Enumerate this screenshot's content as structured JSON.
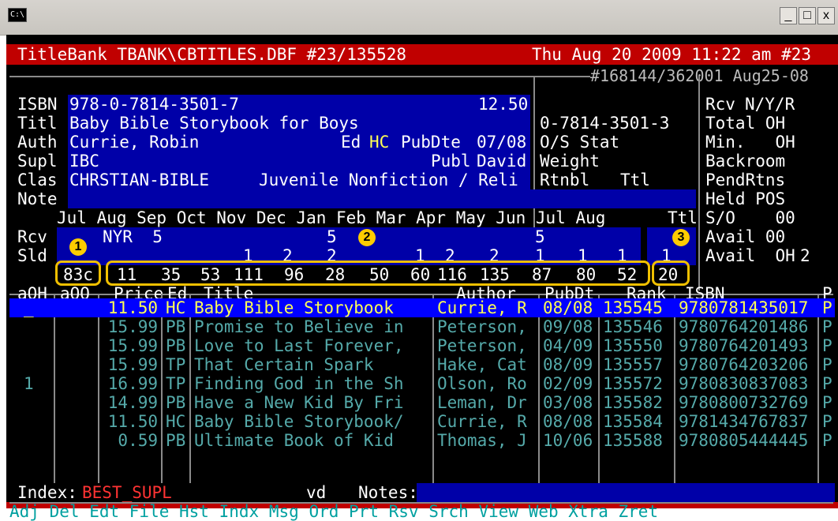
{
  "window": {
    "icon_label": "C:\\",
    "min_label": "_",
    "max_label": "□",
    "close_label": "x"
  },
  "header": {
    "left": "TitleBank TBANK\\CBTITLES.DBF #23/135528",
    "right": "Thu Aug 20 2009 11:22 am #23",
    "sub": "#168144/362001 Aug25-08"
  },
  "record": {
    "isbn_label": "ISBN",
    "isbn": "978-0-7814-3501-7",
    "price": "12.50",
    "titl_label": "Titl",
    "title": "Baby Bible Storybook for Boys",
    "isbn10": "0-7814-3501-3",
    "auth_label": "Auth",
    "author": "Currie, Robin",
    "ed_label": "Ed",
    "ed": "HC",
    "pubdte_label": "PubDte",
    "pubdte": "07/08",
    "os_label": "O/S Stat",
    "supl_label": "Supl",
    "supl": "IBC",
    "publ_label": "Publ",
    "publ": "David",
    "weight_label": "Weight",
    "clas_label": "Clas",
    "clas": "CHRSTIAN-BIBLE",
    "category": "Juvenile Nonfiction / Reli",
    "rtnbl_label": "Rtnbl",
    "ttl_label": "Ttl",
    "note_label": "Note"
  },
  "sidepanel": {
    "rcv_label": "Rcv",
    "rcv_value": "N/Y/R",
    "total": "Total OH",
    "min": "Min.   OH",
    "backroom": "Backroom",
    "pendrtns": "PendRtns",
    "held": "Held POS",
    "so": "S/O    00",
    "avail1": "Avail 00",
    "avail2": "Avail  OH",
    "avail2_val": "2"
  },
  "months": {
    "header": "Jul Aug Sep Oct Nov Dec Jan Feb Mar Apr May Jun Jul Aug",
    "ttl": "Ttl",
    "rcv_label": "Rcv",
    "rcv": "NYR  5",
    "rcv_jan": "5",
    "rcv_jun": "5",
    "sld_label": "Sld",
    "sld_vals": [
      "1",
      "2",
      "2",
      "1",
      "2",
      "2",
      "1",
      "1",
      "1",
      "1"
    ],
    "code": "83c",
    "sales": [
      "11",
      "35",
      "53",
      "111",
      "96",
      "28",
      "50",
      "60",
      "116",
      "135",
      "87",
      "80",
      "52"
    ],
    "total": "20"
  },
  "badges": {
    "one": "1",
    "two": "2",
    "three": "3"
  },
  "table": {
    "headers": {
      "aoh": "aOH",
      "aoo": "aOO",
      "price": "Price",
      "ed": "Ed",
      "title": "Title",
      "author": "Author",
      "pubdt": "PubDt",
      "rank": "Rank",
      "isbn": "ISBN",
      "p": "P"
    },
    "rows": [
      {
        "aoh": "_",
        "aoo": "",
        "price": "11.50",
        "ed": "HC",
        "title": "Baby Bible Storybook",
        "author": "Currie, R",
        "pubdt": "08/08",
        "rank": "135545",
        "isbn": "9780781435017",
        "p": "P"
      },
      {
        "aoh": "",
        "aoo": "",
        "price": "15.99",
        "ed": "PB",
        "title": "Promise to Believe in",
        "author": "Peterson,",
        "pubdt": "09/08",
        "rank": "135546",
        "isbn": "9780764201486",
        "p": "P"
      },
      {
        "aoh": "",
        "aoo": "",
        "price": "15.99",
        "ed": "PB",
        "title": "Love to Last Forever,",
        "author": "Peterson,",
        "pubdt": "04/09",
        "rank": "135550",
        "isbn": "9780764201493",
        "p": "P"
      },
      {
        "aoh": "",
        "aoo": "",
        "price": "15.99",
        "ed": "TP",
        "title": "That Certain Spark",
        "author": "Hake, Cat",
        "pubdt": "08/09",
        "rank": "135557",
        "isbn": "9780764203206",
        "p": "P"
      },
      {
        "aoh": "1",
        "aoo": "",
        "price": "16.99",
        "ed": "TP",
        "title": "Finding God in the Sh",
        "author": "Olson, Ro",
        "pubdt": "02/09",
        "rank": "135572",
        "isbn": "9780830837083",
        "p": "P"
      },
      {
        "aoh": "",
        "aoo": "",
        "price": "14.99",
        "ed": "PB",
        "title": "Have a New Kid By Fri",
        "author": "Leman, Dr",
        "pubdt": "03/08",
        "rank": "135582",
        "isbn": "9780800732769",
        "p": "P"
      },
      {
        "aoh": "",
        "aoo": "",
        "price": "11.50",
        "ed": "HC",
        "title": "Baby Bible Storybook/",
        "author": "Currie, R",
        "pubdt": "08/08",
        "rank": "135584",
        "isbn": "9781434767837",
        "p": "P"
      },
      {
        "aoh": "",
        "aoo": "",
        "price": "0.59",
        "ed": "PB",
        "title": "Ultimate Book of Kid",
        "author": "Thomas, J",
        "pubdt": "10/06",
        "rank": "135588",
        "isbn": "9780805444445",
        "p": "P"
      }
    ]
  },
  "footer": {
    "index_label": "Index:",
    "index_value": "BEST_SUPL",
    "vd": "vd",
    "notes_label": "Notes:",
    "menu": [
      "Adj",
      "Del",
      "Edt",
      "File",
      "Hst",
      "Indx",
      "Msg",
      "Ord",
      "Prt",
      "Rsv",
      "Srch",
      "View",
      "Web",
      "Xtra",
      "Zret"
    ]
  }
}
